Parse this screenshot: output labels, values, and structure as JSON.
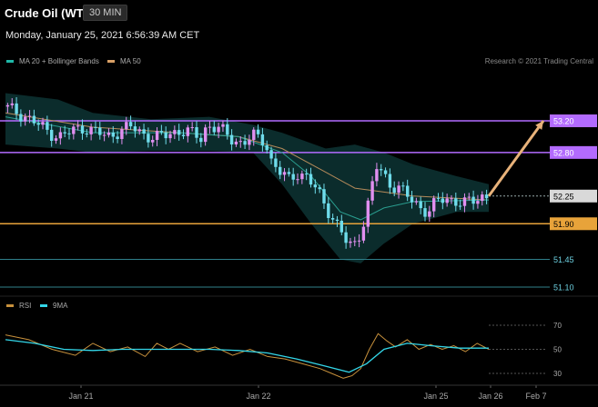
{
  "header": {
    "title": "Crude Oil (WTI)",
    "timeframe": "30 MIN",
    "datetime": "Monday, January 25, 2021 6:56:39 AM CET"
  },
  "legend": {
    "main": [
      {
        "label": "MA 20 + Bollinger Bands",
        "color": "#1fb8a8"
      },
      {
        "label": "MA 50",
        "color": "#d9a066"
      }
    ],
    "rsi": [
      {
        "label": "RSI",
        "color": "#c8913c"
      },
      {
        "label": "9MA",
        "color": "#33d6e8"
      }
    ],
    "credit": "Research © 2021 Trading Central"
  },
  "colors": {
    "up": "#e08ff0",
    "down": "#6fdceb",
    "resistance": "#b36bff",
    "support": "#e8a33a",
    "target_arrow": "#e8b27a",
    "minor_line": "#2f7f8a"
  },
  "chart_data": [
    {
      "type": "candlestick",
      "series_names": [
        "MA 20 + Bollinger Bands",
        "MA 50"
      ],
      "ylim": [
        50.9,
        53.55
      ],
      "x_tick_labels": [
        "Jan 21",
        "Jan 22",
        "Jan 25",
        "Jan 26",
        "Feb 7"
      ],
      "levels": [
        {
          "value": 53.2,
          "label": "53.20",
          "kind": "resistance"
        },
        {
          "value": 52.8,
          "label": "52.80",
          "kind": "resistance"
        },
        {
          "value": 52.25,
          "label": "52.25",
          "kind": "current"
        },
        {
          "value": 51.9,
          "label": "51.90",
          "kind": "support"
        },
        {
          "value": 51.45,
          "label": "51.45",
          "kind": "minor"
        },
        {
          "value": 51.1,
          "label": "51.10",
          "kind": "minor"
        }
      ],
      "close_path": [
        [
          0,
          53.38
        ],
        [
          4,
          53.32
        ],
        [
          8,
          53.25
        ],
        [
          12,
          53.15
        ],
        [
          16,
          53.05
        ],
        [
          20,
          53.0
        ],
        [
          24,
          53.08
        ],
        [
          28,
          53.12
        ],
        [
          32,
          53.05
        ],
        [
          36,
          53.0
        ],
        [
          40,
          53.08
        ],
        [
          44,
          53.12
        ],
        [
          48,
          53.04
        ],
        [
          52,
          52.98
        ],
        [
          56,
          53.02
        ],
        [
          60,
          53.08
        ],
        [
          64,
          53.05
        ],
        [
          68,
          52.98
        ],
        [
          70,
          53.15
        ],
        [
          74,
          53.1
        ],
        [
          78,
          52.98
        ],
        [
          82,
          52.92
        ],
        [
          86,
          53.0
        ],
        [
          90,
          52.95
        ],
        [
          92,
          52.7
        ],
        [
          95,
          52.55
        ],
        [
          98,
          52.45
        ],
        [
          101,
          52.55
        ],
        [
          104,
          52.5
        ],
        [
          108,
          52.3
        ],
        [
          112,
          52.05
        ],
        [
          116,
          51.8
        ],
        [
          118,
          51.65
        ],
        [
          120,
          51.6
        ],
        [
          122,
          51.75
        ],
        [
          124,
          51.95
        ],
        [
          126,
          52.25
        ],
        [
          128,
          52.62
        ],
        [
          130,
          52.55
        ],
        [
          133,
          52.4
        ],
        [
          136,
          52.35
        ],
        [
          140,
          52.2
        ],
        [
          143,
          52.12
        ],
        [
          146,
          52.05
        ],
        [
          149,
          52.18
        ],
        [
          152,
          52.22
        ],
        [
          155,
          52.2
        ],
        [
          158,
          52.15
        ],
        [
          161,
          52.18
        ],
        [
          164,
          52.25
        ],
        [
          166,
          52.25
        ]
      ],
      "ma50_path": [
        [
          0,
          53.3
        ],
        [
          30,
          53.12
        ],
        [
          60,
          53.05
        ],
        [
          80,
          53.0
        ],
        [
          95,
          52.85
        ],
        [
          110,
          52.55
        ],
        [
          120,
          52.35
        ],
        [
          130,
          52.3
        ],
        [
          140,
          52.25
        ],
        [
          166,
          52.2
        ]
      ],
      "ma20_path": [
        [
          0,
          53.25
        ],
        [
          30,
          53.05
        ],
        [
          60,
          53.05
        ],
        [
          80,
          53.0
        ],
        [
          95,
          52.8
        ],
        [
          105,
          52.5
        ],
        [
          115,
          52.05
        ],
        [
          122,
          51.95
        ],
        [
          130,
          52.1
        ],
        [
          140,
          52.18
        ],
        [
          166,
          52.2
        ]
      ],
      "bb_upper": [
        [
          0,
          53.55
        ],
        [
          18,
          53.47
        ],
        [
          30,
          53.3
        ],
        [
          50,
          53.22
        ],
        [
          70,
          53.25
        ],
        [
          85,
          53.15
        ],
        [
          95,
          53.05
        ],
        [
          110,
          52.85
        ],
        [
          120,
          52.9
        ],
        [
          130,
          52.8
        ],
        [
          140,
          52.65
        ],
        [
          155,
          52.5
        ],
        [
          166,
          52.4
        ]
      ],
      "bb_lower": [
        [
          0,
          52.9
        ],
        [
          18,
          52.85
        ],
        [
          30,
          52.8
        ],
        [
          50,
          52.82
        ],
        [
          70,
          52.82
        ],
        [
          85,
          52.8
        ],
        [
          95,
          52.4
        ],
        [
          105,
          51.9
        ],
        [
          115,
          51.45
        ],
        [
          122,
          51.4
        ],
        [
          130,
          51.65
        ],
        [
          140,
          51.9
        ],
        [
          155,
          52.05
        ],
        [
          166,
          52.05
        ]
      ],
      "projection": [
        [
          166,
          52.25
        ],
        [
          188,
          53.2
        ]
      ]
    },
    {
      "type": "line",
      "series_names": [
        "RSI",
        "9MA"
      ],
      "ylim": [
        20,
        80
      ],
      "y_ticks": [
        70,
        50,
        30
      ],
      "rsi": [
        [
          0,
          62
        ],
        [
          8,
          58
        ],
        [
          16,
          50
        ],
        [
          24,
          45
        ],
        [
          30,
          55
        ],
        [
          36,
          48
        ],
        [
          42,
          52
        ],
        [
          48,
          44
        ],
        [
          52,
          55
        ],
        [
          56,
          50
        ],
        [
          60,
          55
        ],
        [
          66,
          48
        ],
        [
          72,
          52
        ],
        [
          78,
          45
        ],
        [
          84,
          50
        ],
        [
          90,
          44
        ],
        [
          96,
          42
        ],
        [
          102,
          38
        ],
        [
          108,
          34
        ],
        [
          112,
          30
        ],
        [
          116,
          26
        ],
        [
          119,
          28
        ],
        [
          122,
          34
        ],
        [
          125,
          50
        ],
        [
          128,
          63
        ],
        [
          131,
          57
        ],
        [
          134,
          52
        ],
        [
          138,
          58
        ],
        [
          142,
          50
        ],
        [
          146,
          54
        ],
        [
          150,
          50
        ],
        [
          154,
          53
        ],
        [
          158,
          48
        ],
        [
          162,
          55
        ],
        [
          166,
          50
        ]
      ],
      "ma9": [
        [
          0,
          58
        ],
        [
          10,
          55
        ],
        [
          20,
          50
        ],
        [
          30,
          49
        ],
        [
          40,
          50
        ],
        [
          50,
          50
        ],
        [
          60,
          50
        ],
        [
          70,
          50
        ],
        [
          80,
          49
        ],
        [
          90,
          47
        ],
        [
          100,
          42
        ],
        [
          110,
          36
        ],
        [
          118,
          31
        ],
        [
          124,
          38
        ],
        [
          130,
          50
        ],
        [
          138,
          55
        ],
        [
          146,
          53
        ],
        [
          156,
          51
        ],
        [
          166,
          51
        ]
      ]
    }
  ]
}
